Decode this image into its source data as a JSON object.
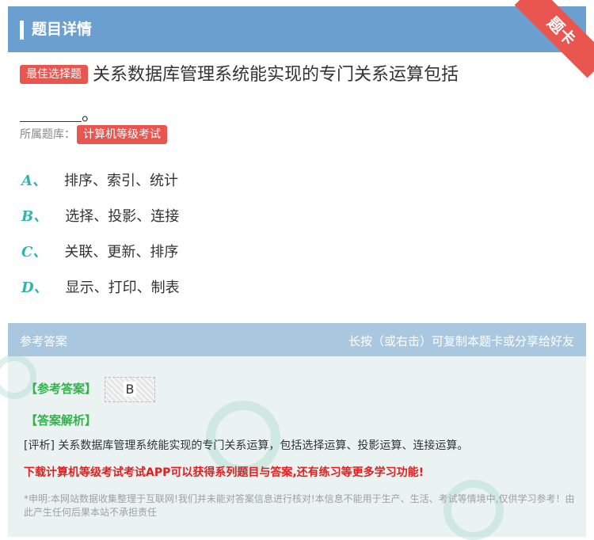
{
  "header": {
    "title": "题目详情",
    "ribbon": "题卡"
  },
  "question": {
    "type_tag": "最佳选择题",
    "text": "关系数据库管理系统能实现的专门关系运算包括",
    "end_mark": "。",
    "bank_label": "所属题库：",
    "bank_tag": "计算机等级考试"
  },
  "options": [
    {
      "letter": "A、",
      "text": "排序、索引、统计"
    },
    {
      "letter": "B、",
      "text": "选择、投影、连接"
    },
    {
      "letter": "C、",
      "text": "关联、更新、排序"
    },
    {
      "letter": "D、",
      "text": "显示、打印、制表"
    }
  ],
  "answer": {
    "head_left": "参考答案",
    "head_right": "长按（或右击）可复制本题卡或分享给好友",
    "ans_label": "【参考答案】",
    "ans_value": "B",
    "analysis_label": "【答案解析】",
    "analysis_text": "[评析] 关系数据库管理系统能实现的专门关系运算，包括选择运算、投影运算、连接运算。",
    "promo": "下载计算机等级考试考试APP可以获得系列题目与答案,还有练习等更多学习功能!",
    "disclaimer": "*申明:本网站数据收集整理于互联网!我们并未能对答案信息进行核对!本信息不能用于生产、生活、考试等情境中,仅供学习参考！由此产生任何后果本站不承担责任"
  },
  "colors": {
    "header": "#6b9fd0",
    "tag": "#e8564f",
    "option_letter": "#2fb5b0",
    "green": "#2fb54a",
    "promo": "#e02020"
  }
}
